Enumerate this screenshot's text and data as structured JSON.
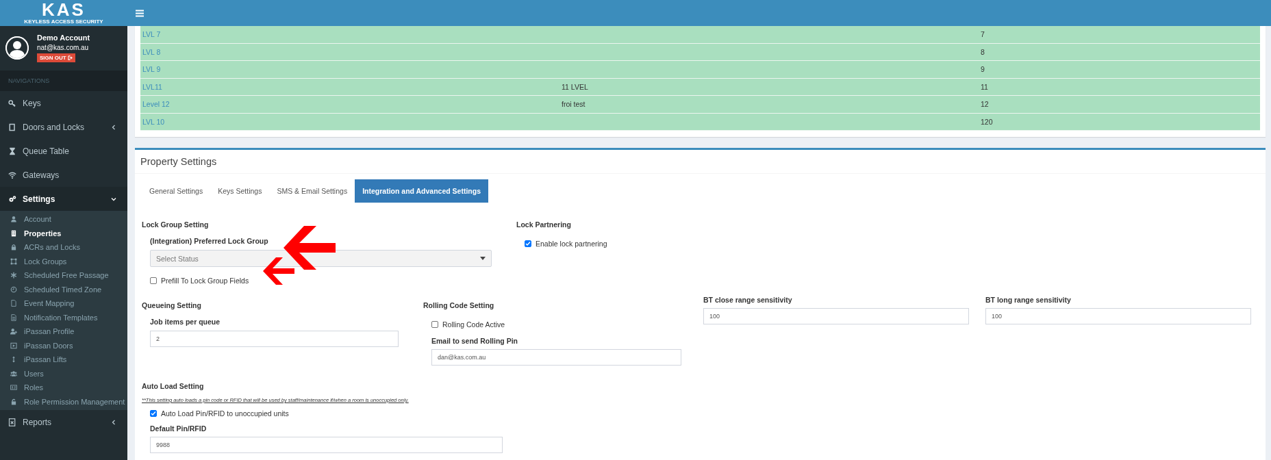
{
  "logo": {
    "title": "KAS",
    "tagline": "KEYLESS ACCESS SECURITY"
  },
  "user": {
    "name": "Demo Account",
    "email": "nat@kas.com.au",
    "sign_out": "SIGN OUT"
  },
  "sidebar": {
    "header": "NAVIGATIONS",
    "items": [
      {
        "kind": "link",
        "label": "Keys"
      },
      {
        "kind": "group",
        "label": "Doors and Locks",
        "expanded": false
      },
      {
        "kind": "link",
        "label": "Queue Table"
      },
      {
        "kind": "link",
        "label": "Gateways"
      },
      {
        "kind": "group",
        "label": "Settings",
        "expanded": true,
        "children": [
          {
            "label": "Account",
            "selected": false
          },
          {
            "label": "Properties",
            "selected": true
          },
          {
            "label": "ACRs and Locks",
            "selected": false
          },
          {
            "label": "Lock Groups",
            "selected": false
          },
          {
            "label": "Scheduled Free Passage",
            "selected": false
          },
          {
            "label": "Scheduled Timed Zone",
            "selected": false
          },
          {
            "label": "Event Mapping",
            "selected": false
          },
          {
            "label": "Notification Templates",
            "selected": false
          },
          {
            "label": "iPassan Profile",
            "selected": false
          },
          {
            "label": "iPassan Doors",
            "selected": false
          },
          {
            "label": "iPassan Lifts",
            "selected": false
          },
          {
            "label": "Users",
            "selected": false
          },
          {
            "label": "Roles",
            "selected": false
          },
          {
            "label": "Role Permission Management",
            "selected": false
          }
        ]
      },
      {
        "kind": "group",
        "label": "Reports",
        "expanded": false
      }
    ]
  },
  "table": {
    "rows": [
      {
        "column_1": "LVL 7",
        "column_3": "7"
      },
      {
        "column_1": "LVL 8",
        "column_3": "8"
      },
      {
        "column_1": "LVL 9",
        "column_3": "9"
      },
      {
        "column_1": "LVL11",
        "column_2": "11 LVEL",
        "column_3": "11"
      },
      {
        "column_1": "Level 12",
        "column_2": "froi test",
        "column_3": "12"
      },
      {
        "column_1": "LVL 10",
        "column_3": "120"
      }
    ]
  },
  "property_settings": {
    "title": "Property Settings",
    "tabs": [
      {
        "label": "General Settings",
        "selected": false
      },
      {
        "label": "Keys Settings",
        "selected": false
      },
      {
        "label": "SMS & Email Settings",
        "selected": false
      },
      {
        "label": "Integration and Advanced Settings",
        "selected": true
      }
    ],
    "lock_group_setting": {
      "heading": "Lock Group Setting",
      "field_label": "(Integration) Preferred Lock Group",
      "select": {
        "placeholder": "Select Status"
      },
      "checkbox": {
        "label": "Prefill To Lock Group Fields",
        "checked": false
      }
    },
    "lock_partnering": {
      "heading": "Lock Partnering",
      "checkbox": {
        "label": "Enable lock partnering",
        "checked": true
      }
    },
    "queueing_setting": {
      "heading": "Queueing Setting",
      "field_label": "Job items per queue",
      "value": "2"
    },
    "rolling_code_setting": {
      "heading": "Rolling Code Setting",
      "checkbox": {
        "label": "Rolling Code Active",
        "checked": false
      },
      "field_label": "Email to send Rolling Pin",
      "value": "dan@kas.com.au"
    },
    "bt_close_range": {
      "field_label": "BT close range sensitivity",
      "value": "100"
    },
    "bt_long_range": {
      "field_label": "BT long range sensitivity",
      "value": "100"
    },
    "auto_load_setting": {
      "heading": "Auto Load Setting",
      "note": "**This setting auto loads a pin code or RFID that will be used by staff/maintenance if/when a room is unoccupied only.",
      "checkbox": {
        "label": "Auto Load Pin/RFID to unoccupied units",
        "checked": true
      },
      "field_label": "Default Pin/RFID",
      "value": "9988"
    }
  }
}
